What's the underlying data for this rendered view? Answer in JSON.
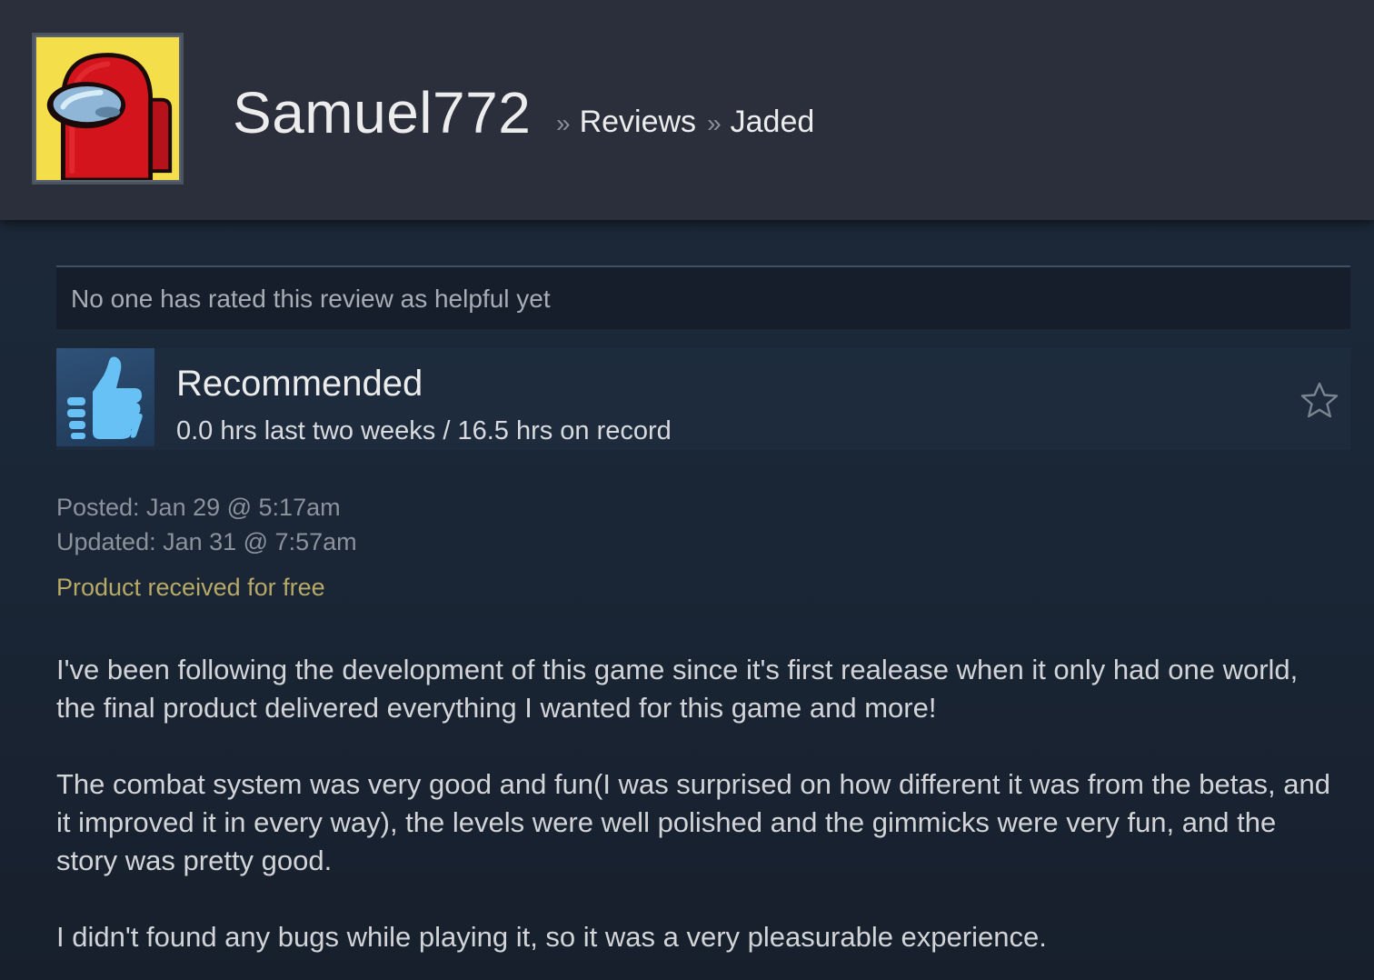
{
  "header": {
    "persona_name": "Samuel772",
    "breadcrumb_sep": "»",
    "breadcrumbs": [
      "Reviews",
      "Jaded"
    ]
  },
  "helpful": {
    "text": "No one has rated this review as helpful yet"
  },
  "verdict": {
    "title": "Recommended",
    "hours": "0.0 hrs last two weeks / 16.5 hrs on record",
    "icon": "thumbs-up-icon"
  },
  "meta": {
    "posted": "Posted: Jan 29 @ 5:17am",
    "updated": "Updated: Jan 31 @ 7:57am",
    "free_label": "Product received for free"
  },
  "review": {
    "paragraphs": [
      "I've been following the development of this game since it's first realease when it only had one world, the final product delivered everything I wanted for this game and more!",
      "The combat system was very good and fun(I was surprised on how different it was from the betas, and it improved it in every way), the levels were well polished and the gimmicks were very fun, and the story was pretty good.",
      "I didn't found any bugs while playing it, so it was a very pleasurable experience."
    ]
  },
  "colors": {
    "background": "#1b2838",
    "header_bg": "#2b2f3b",
    "free_label": "#b7a966",
    "thumb_icon": "#67c1f5"
  }
}
